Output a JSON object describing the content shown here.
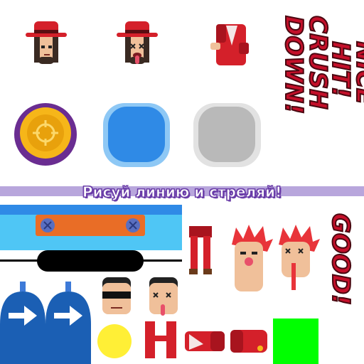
{
  "banner": {
    "text": "Рисуй линию и стреляй!"
  },
  "labels": {
    "crush": "CRUSH DOWN!",
    "nice": "NICE HIT!",
    "good": "GOOD!"
  },
  "colors": {
    "hat_red": "#d4202a",
    "skin": "#f0c09a",
    "coin_gold": "#f6b619",
    "coin_rim": "#6a2d91",
    "btn_blue": "#2f8ae6",
    "btn_blue_rim": "#8ec8f5",
    "btn_gray": "#b9b9b9",
    "btn_gray_rim": "#e2e2e2",
    "bar_purple": "#b8a6dc",
    "plank_orange": "#e96d26",
    "sky_blue": "#4fc6f5",
    "door_blue": "#1b5fb4",
    "yellow": "#ffef36",
    "green": "#00ff00",
    "text_red": "#c4102a"
  },
  "icons": [
    "cowboy-head-icon",
    "dead-cowboy-head-icon",
    "red-torso-icon",
    "coin-target-icon",
    "arrow-right-icon",
    "screw-icon",
    "sunglasses-agent-icon",
    "dead-agent-icon",
    "redhead-head-icon",
    "dead-redhead-head-icon",
    "red-legs-icon"
  ]
}
